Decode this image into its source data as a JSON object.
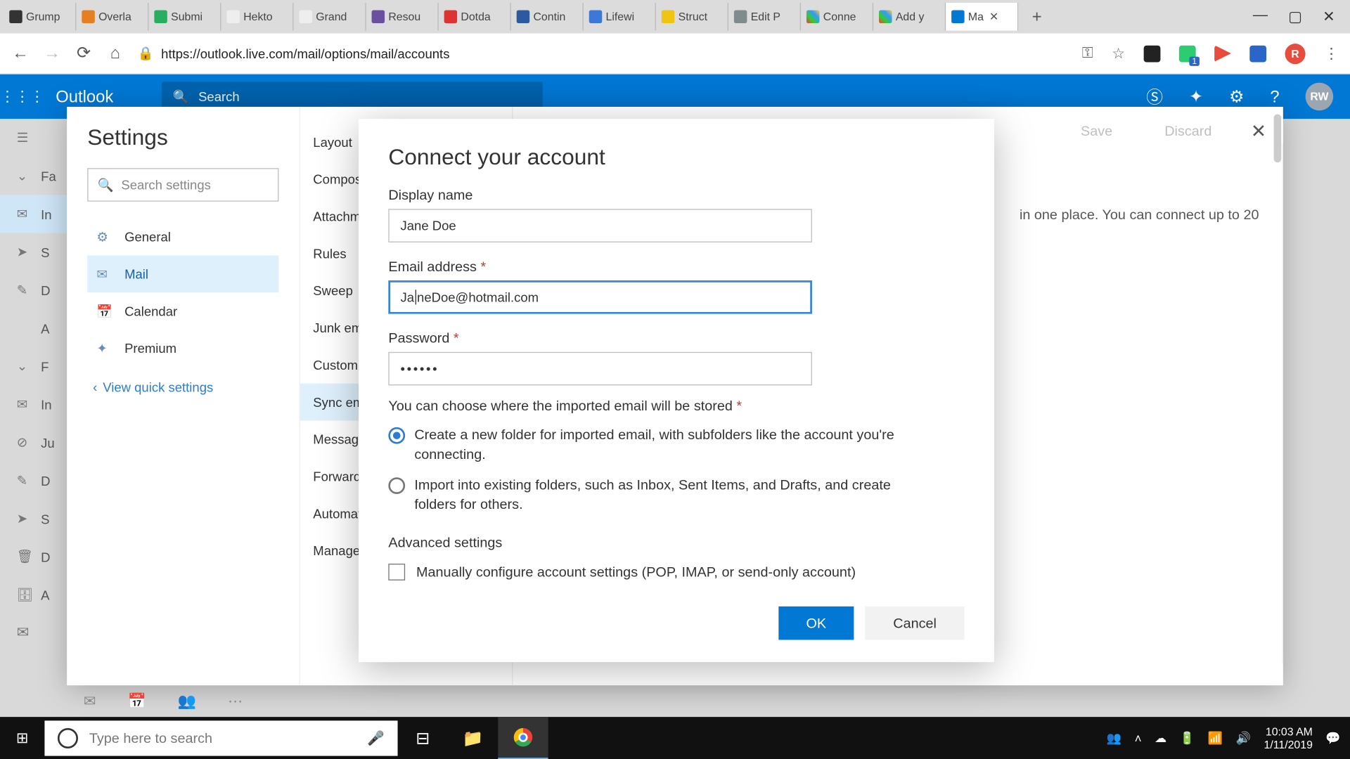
{
  "browser": {
    "tabs": [
      "Grump",
      "Overla",
      "Submi",
      "Hekto",
      "Grand",
      "Resou",
      "Dotda",
      "Contin",
      "Lifewi",
      "Struct",
      "Edit P",
      "Conne",
      "Add y",
      "Ma"
    ],
    "active_tab_index": 13,
    "url": "https://outlook.live.com/mail/options/mail/accounts",
    "user_avatar": "R"
  },
  "suite": {
    "app": "Outlook",
    "search_placeholder": "Search",
    "avatar": "RW"
  },
  "left_sliver": {
    "burger": "☰",
    "rows": [
      {
        "icon": "⌄",
        "label": "Fa"
      },
      {
        "icon": "✉",
        "label": "In"
      },
      {
        "icon": "➤",
        "label": "S"
      },
      {
        "icon": "✎",
        "label": "D"
      },
      {
        "icon": "",
        "label": "A"
      },
      {
        "icon": "⌄",
        "label": "F"
      },
      {
        "icon": "✉",
        "label": "In"
      },
      {
        "icon": "⊘",
        "label": "Ju"
      },
      {
        "icon": "✎",
        "label": "D"
      },
      {
        "icon": "➤",
        "label": "S"
      },
      {
        "icon": "🗑",
        "label": "D"
      },
      {
        "icon": "🗄",
        "label": "A"
      }
    ]
  },
  "settings": {
    "title": "Settings",
    "search_placeholder": "Search settings",
    "categories": [
      {
        "icon": "⚙",
        "label": "General"
      },
      {
        "icon": "✉",
        "label": "Mail"
      },
      {
        "icon": "📅",
        "label": "Calendar"
      },
      {
        "icon": "✦",
        "label": "Premium"
      }
    ],
    "selected_category": 1,
    "quick": "View quick settings",
    "sub_items": [
      "Layout",
      "Compose",
      "Attachments",
      "Rules",
      "Sweep",
      "Junk email",
      "Customize",
      "Sync email",
      "Message handling",
      "Forwarding",
      "Automatic replies",
      "Manage"
    ],
    "selected_sub": 7,
    "save": "Save",
    "discard": "Discard",
    "hint_tail": "in one place. You can connect up to 20"
  },
  "modal": {
    "title": "Connect your account",
    "display_name_label": "Display name",
    "display_name_value": "Jane Doe",
    "email_label": "Email address",
    "email_value_pre": "Ja",
    "email_value_post": "neDoe@hotmail.com",
    "password_label": "Password",
    "password_value": "••••••",
    "storage_hint": "You can choose where the imported email will be stored",
    "radio1": "Create a new folder for imported email, with subfolders like the account you're connecting.",
    "radio2": "Import into existing folders, such as Inbox, Sent Items, and Drafts, and create folders for others.",
    "advanced": "Advanced settings",
    "manual": "Manually configure account settings (POP, IMAP, or send-only account)",
    "ok": "OK",
    "cancel": "Cancel"
  },
  "taskbar": {
    "search_placeholder": "Type here to search",
    "time": "10:03 AM",
    "date": "1/11/2019"
  }
}
